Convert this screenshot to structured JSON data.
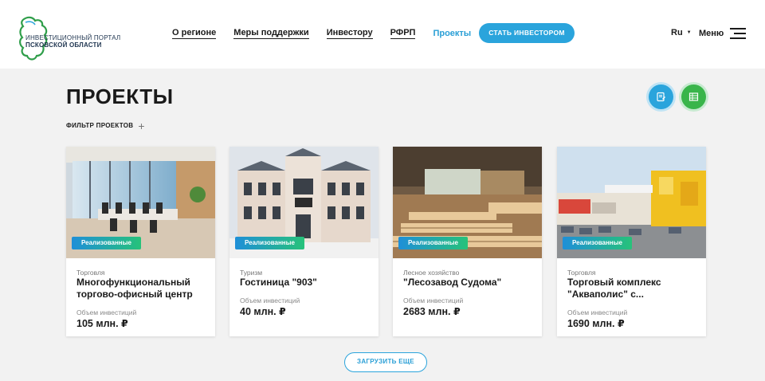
{
  "logo": {
    "line1": "Инвестиционный портал",
    "line2": "Псковской области"
  },
  "nav": [
    {
      "label": "О регионе"
    },
    {
      "label": "Меры поддержки"
    },
    {
      "label": "Инвестору"
    },
    {
      "label": "РФРП"
    },
    {
      "label": "Проекты",
      "active": true
    }
  ],
  "cta_label": "СТАТЬ ИНВЕСТОРОМ",
  "lang": {
    "label": "Ru",
    "caret": "▼"
  },
  "menu_label": "Меню",
  "page_title": "ПРОЕКТЫ",
  "filter_label": "ФИЛЬТР ПРОЕКТОВ",
  "filter_icon": "+",
  "action_buttons": [
    {
      "icon": "edit-document-icon",
      "color": "#2aa4dc"
    },
    {
      "icon": "spreadsheet-icon",
      "color": "#39b54a"
    }
  ],
  "volume_label": "Объем инвестиций",
  "cards": [
    {
      "badge": "Реализованные",
      "category": "Торговля",
      "name": "Многофункциональный торгово-офисный центр",
      "volume": "105 млн. ₽"
    },
    {
      "badge": "Реализованные",
      "category": "Туризм",
      "name": "Гостиница \"903\"",
      "volume": "40 млн. ₽"
    },
    {
      "badge": "Реализованные",
      "category": "Лесное хозяйство",
      "name": "\"Лесозавод Судома\"",
      "volume": "2683 млн. ₽"
    },
    {
      "badge": "Реализованные",
      "category": "Торговля",
      "name": "Торговый комплекс \"Акваполис\" с...",
      "volume": "1690 млн. ₽"
    }
  ],
  "load_more_label": "ЗАГРУЗИТЬ ЕЩЕ",
  "colors": {
    "accent": "#2aa4dc",
    "green": "#39b54a",
    "page_bg": "#f2f2f2"
  }
}
